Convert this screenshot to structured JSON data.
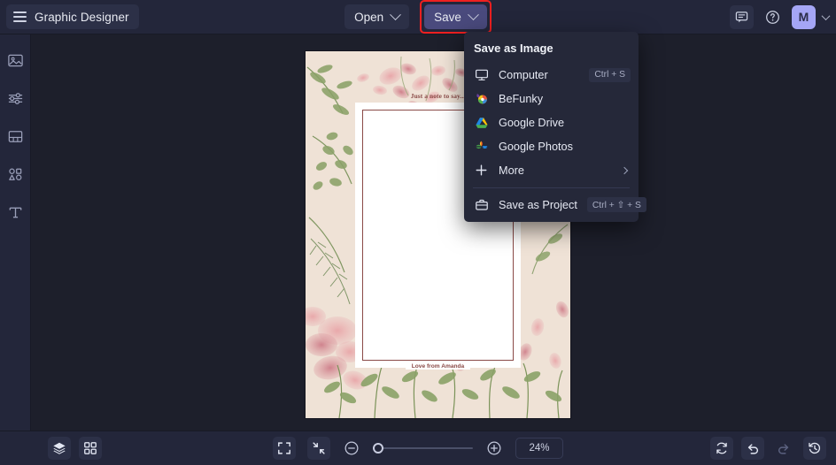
{
  "header": {
    "app_title": "Graphic Designer",
    "menu_icon": "hamburger-icon",
    "open_label": "Open",
    "save_label": "Save",
    "feedback_icon": "chat-bubble-icon",
    "help_icon": "question-circle-icon",
    "avatar_initial": "M",
    "account_caret_icon": "chevron-down-icon",
    "save_highlight_color": "#ef2020",
    "save_button_color": "#4a4a7d",
    "avatar_color": "#a5a6f6"
  },
  "sidebar": {
    "items": [
      {
        "name": "image-tool",
        "icon": "image-icon"
      },
      {
        "name": "edit-tool",
        "icon": "sliders-icon"
      },
      {
        "name": "frames-tool",
        "icon": "frame-icon"
      },
      {
        "name": "graphics-tool",
        "icon": "shapes-icon"
      },
      {
        "name": "text-tool",
        "icon": "text-icon"
      }
    ]
  },
  "save_menu": {
    "title": "Save as Image",
    "items": [
      {
        "label": "Computer",
        "icon": "monitor-icon",
        "shortcut": "Ctrl + S"
      },
      {
        "label": "BeFunky",
        "icon": "befunky-logo-icon",
        "shortcut": ""
      },
      {
        "label": "Google Drive",
        "icon": "google-drive-icon",
        "shortcut": ""
      },
      {
        "label": "Google Photos",
        "icon": "google-photos-icon",
        "shortcut": ""
      },
      {
        "label": "More",
        "icon": "plus-icon",
        "shortcut": "",
        "has_submenu": true
      }
    ],
    "project": {
      "label": "Save as Project",
      "icon": "briefcase-icon",
      "shortcut": "Ctrl + ⇧ + S"
    }
  },
  "canvas": {
    "note_heading": "Just a note to say...",
    "note_signature": "Love from Amanda",
    "paper_color": "#ffffff",
    "background_color": "#efe2d6",
    "accent_color": "#8a4a47"
  },
  "bottombar": {
    "layers_icon": "layers-icon",
    "grid_icon": "grid-icon",
    "fit_icon": "fit-to-screen-icon",
    "shrink_icon": "collapse-icon",
    "zoom_out_icon": "minus-circle-icon",
    "zoom_in_icon": "plus-circle-icon",
    "zoom_value": "24%",
    "zoom_percent": 24,
    "reset_icon": "reset-icon",
    "undo_icon": "undo-icon",
    "redo_icon": "redo-icon",
    "history_icon": "history-clock-icon"
  }
}
